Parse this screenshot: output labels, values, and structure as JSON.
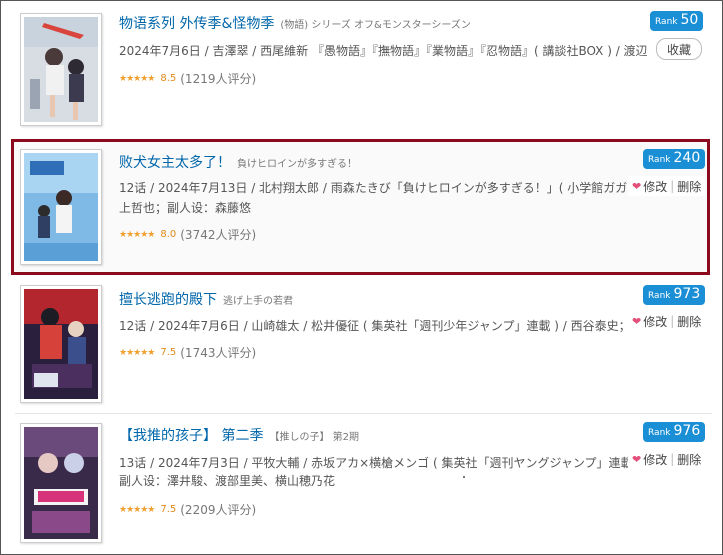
{
  "items": [
    {
      "title": "物语系列 外传季&怪物季",
      "subtitle": "(物語) シリーズ オフ&モンスターシーズン",
      "info_line1": "2024年7月6日 / 吉澤翠 / 西尾維新 『愚物語』『撫物語』『業物語』『忍物語』( 講談社BOX ) / 渡辺",
      "info_line2": "",
      "stars": "★★★★★",
      "score": "8.5",
      "count": "(1219人评分)",
      "rank_label": "Rank",
      "rank_number": "50",
      "action_label": "收藏",
      "cover_icon": "anime-cover-image"
    },
    {
      "title": "败犬女主太多了！",
      "subtitle": "負けヒロインが多すぎる！",
      "info_line1": "12话 / 2024年7月13日 / 北村翔太郎 / 雨森たきび「負けヒロインが多すぎる！」( 小学館ガガガ",
      "info_line2": "上哲也；副人设：森藤悠",
      "stars": "★★★★★",
      "score": "8.0",
      "count": "(3742人评分)",
      "rank_label": "Rank",
      "rank_number": "240",
      "edit_label": "修改",
      "delete_label": "删除",
      "cover_icon": "anime-cover-image"
    },
    {
      "title": "擅长逃跑的殿下",
      "subtitle": "逃げ上手の若君",
      "info_line1": "12话 / 2024年7月6日 / 山崎雄太 / 松井優征 ( 集英社「週刊少年ジャンプ」連載 ) / 西谷泰史；副",
      "info_line2": "",
      "stars": "★★★★★",
      "score": "7.5",
      "count": "(1743人评分)",
      "rank_label": "Rank",
      "rank_number": "973",
      "edit_label": "修改",
      "delete_label": "删除",
      "cover_icon": "anime-cover-image"
    },
    {
      "title": "【我推的孩子】 第二季",
      "subtitle": "【推しの子】 第2期",
      "info_line1": "13话 / 2024年7月3日 / 平牧大輔 / 赤坂アカ×横槍メンゴ ( 集英社「週刊ヤングジャンプ」連載 )",
      "info_line2": "副人设：澤井駿、渡部里美、横山穂乃花",
      "stars": "★★★★★",
      "score": "7.5",
      "count": "(2209人评分)",
      "rank_label": "Rank",
      "rank_number": "976",
      "edit_label": "修改",
      "delete_label": "删除",
      "cover_icon": "anime-cover-image"
    }
  ],
  "colors": {
    "title": "#0066aa",
    "rank_badge": "#1a8fd6",
    "highlight_border": "#8b0a1e",
    "star": "#f0a030",
    "heart": "#e2507a"
  }
}
